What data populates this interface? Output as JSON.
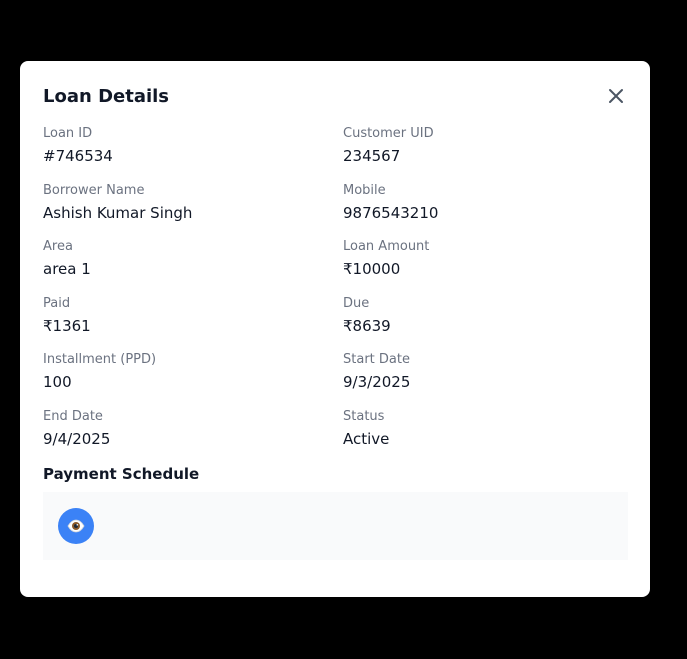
{
  "modal": {
    "title": "Loan Details",
    "close_icon": "close-icon"
  },
  "fields": [
    {
      "key": "loan-id",
      "label": "Loan ID",
      "value": "#746534"
    },
    {
      "key": "customer-uid",
      "label": "Customer UID",
      "value": "234567"
    },
    {
      "key": "borrower-name",
      "label": "Borrower Name",
      "value": "Ashish Kumar Singh"
    },
    {
      "key": "mobile",
      "label": "Mobile",
      "value": "9876543210"
    },
    {
      "key": "area",
      "label": "Area",
      "value": "area 1"
    },
    {
      "key": "loan-amount",
      "label": "Loan Amount",
      "value": "₹10000"
    },
    {
      "key": "paid",
      "label": "Paid",
      "value": "₹1361"
    },
    {
      "key": "due",
      "label": "Due",
      "value": "₹8639"
    },
    {
      "key": "installment",
      "label": "Installment (PPD)",
      "value": "100"
    },
    {
      "key": "start-date",
      "label": "Start Date",
      "value": "9/3/2025"
    },
    {
      "key": "end-date",
      "label": "End Date",
      "value": "9/4/2025"
    },
    {
      "key": "status",
      "label": "Status",
      "value": "Active"
    }
  ],
  "payment_schedule": {
    "title": "Payment Schedule",
    "view_icon": "eye-icon"
  },
  "colors": {
    "backdrop": "#000000",
    "accent": "#3b82f6",
    "label": "#6b7280",
    "value": "#111827",
    "schedule_bg": "#f9fafb"
  }
}
